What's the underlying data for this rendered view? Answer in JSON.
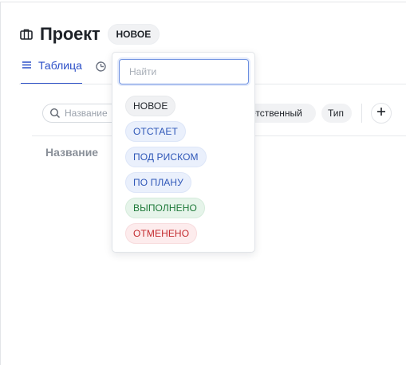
{
  "header": {
    "title": "Проект",
    "status": "НОВОЕ"
  },
  "tabs": [
    {
      "label": "Таблица",
      "active": true
    },
    {
      "label": "",
      "active": false
    }
  ],
  "filters": {
    "search_placeholder": "Название",
    "owner_chip": "ответственный",
    "type_chip": "Тип"
  },
  "columns": {
    "name": "Название"
  },
  "dropdown": {
    "search_placeholder": "Найти",
    "options": [
      {
        "label": "НОВОЕ",
        "color": "#1f2329"
      },
      {
        "label": "ОТСТАЕТ",
        "color": "#2f57b8"
      },
      {
        "label": "ПОД РИСКОМ",
        "color": "#2f57b8"
      },
      {
        "label": "ПО ПЛАНУ",
        "color": "#2f57b8"
      },
      {
        "label": "ВЫПОЛНЕНО",
        "color": "#1f7a3a"
      },
      {
        "label": "ОТМЕНЕНО",
        "color": "#c42b2f"
      }
    ]
  },
  "icons": {
    "project": "briefcase-icon",
    "table": "list-icon",
    "timeline": "clock-icon",
    "search": "search-icon",
    "add": "plus-icon"
  },
  "colors": {
    "accent": "#2b4fc7"
  }
}
